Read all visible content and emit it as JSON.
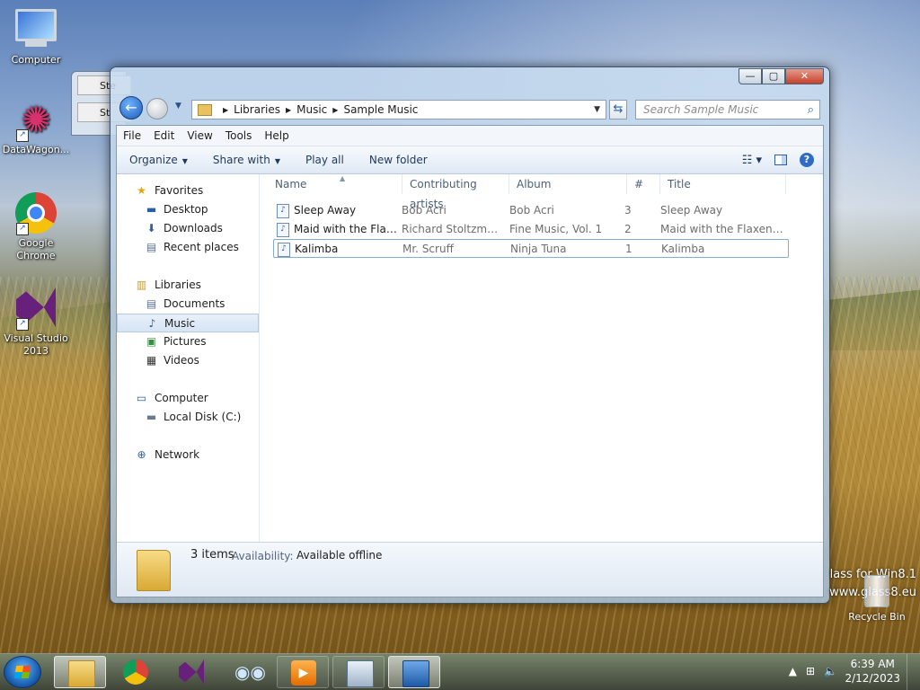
{
  "desktop": {
    "icons": [
      {
        "label": "Computer"
      },
      {
        "label": "DataWagon..."
      },
      {
        "label": "Google Chrome"
      },
      {
        "label": "Visual Studio 2013"
      }
    ],
    "watermark_line1": "lass for Win8.1",
    "watermark_line2": "www.glass8.eu",
    "recycle_bin": "Recycle Bin",
    "back_window_row1": "Ste",
    "back_window_row2": "St"
  },
  "window": {
    "breadcrumb": [
      "Libraries",
      "Music",
      "Sample Music"
    ],
    "search_placeholder": "Search Sample Music",
    "menu": [
      "File",
      "Edit",
      "View",
      "Tools",
      "Help"
    ],
    "commands": {
      "organize": "Organize",
      "share_with": "Share with",
      "play_all": "Play all",
      "new_folder": "New folder"
    }
  },
  "nav_pane": {
    "favorites": "Favorites",
    "desktop": "Desktop",
    "downloads": "Downloads",
    "recent_places": "Recent places",
    "libraries": "Libraries",
    "documents": "Documents",
    "music": "Music",
    "pictures": "Pictures",
    "videos": "Videos",
    "computer": "Computer",
    "local_disk": "Local Disk (C:)",
    "network": "Network"
  },
  "file_list": {
    "columns": [
      "Name",
      "Contributing artists",
      "Album",
      "#",
      "Title"
    ],
    "rows": [
      {
        "name": "Sleep Away",
        "artist": "Bob Acri",
        "album": "Bob Acri",
        "num": "3",
        "title": "Sleep Away"
      },
      {
        "name": "Maid with the Flaxe...",
        "artist": "Richard Stoltzman...",
        "album": "Fine Music, Vol. 1",
        "num": "2",
        "title": "Maid with the Flaxen H..."
      },
      {
        "name": "Kalimba",
        "artist": "Mr. Scruff",
        "album": "Ninja Tuna",
        "num": "1",
        "title": "Kalimba"
      }
    ]
  },
  "details": {
    "count": "3 items",
    "availability_label": "Availability:",
    "availability_value": "Available offline"
  },
  "taskbar": {
    "clock_time": "6:39 AM",
    "clock_date": "2/12/2023"
  }
}
